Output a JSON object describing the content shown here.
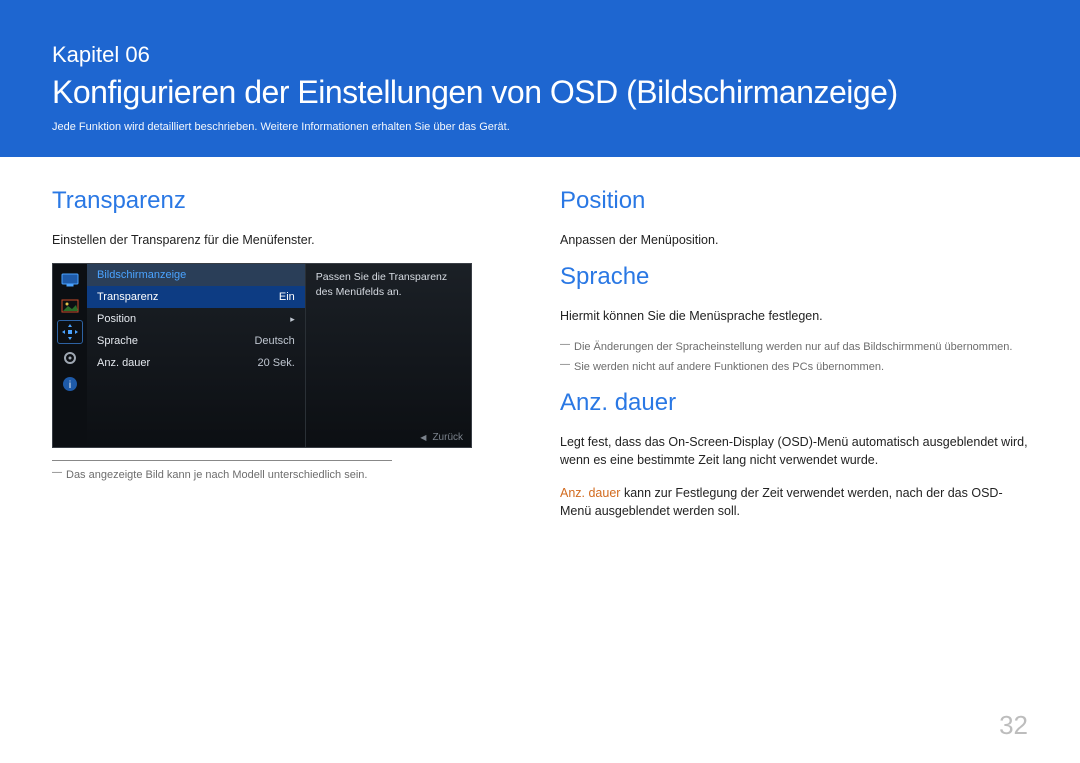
{
  "banner": {
    "chapter": "Kapitel 06",
    "title": "Konfigurieren der Einstellungen von OSD (Bildschirmanzeige)",
    "subtitle": "Jede Funktion wird detailliert beschrieben. Weitere Informationen erhalten Sie über das Gerät."
  },
  "left": {
    "h_transparenz": "Transparenz",
    "transparenz_body": "Einstellen der Transparenz für die Menüfenster.",
    "osd": {
      "header": "Bildschirmanzeige",
      "rows": [
        {
          "label": "Transparenz",
          "value": "Ein",
          "selected": true
        },
        {
          "label": "Position",
          "value": "▸",
          "arrow": true
        },
        {
          "label": "Sprache",
          "value": "Deutsch"
        },
        {
          "label": "Anz. dauer",
          "value": "20 Sek."
        }
      ],
      "desc": "Passen Sie die Transparenz des Menüfelds an.",
      "back": "Zurück"
    },
    "footnote": "Das angezeigte Bild kann je nach Modell unterschiedlich sein."
  },
  "right": {
    "h_position": "Position",
    "position_body": "Anpassen der Menüposition.",
    "h_sprache": "Sprache",
    "sprache_body": "Hiermit können Sie die Menüsprache festlegen.",
    "sprache_note1": "Die Änderungen der Spracheinstellung werden nur auf das Bildschirmmenü übernommen.",
    "sprache_note2": "Sie werden nicht auf andere Funktionen des PCs übernommen.",
    "h_anzdauer": "Anz. dauer",
    "anzdauer_body1": "Legt fest, dass das On-Screen-Display (OSD)-Menü automatisch ausgeblendet wird, wenn es eine bestimmte Zeit lang nicht verwendet wurde.",
    "anzdauer_label": "Anz. dauer",
    "anzdauer_body2": " kann zur Festlegung der Zeit verwendet werden, nach der das OSD-Menü ausgeblendet werden soll."
  },
  "page_number": "32"
}
